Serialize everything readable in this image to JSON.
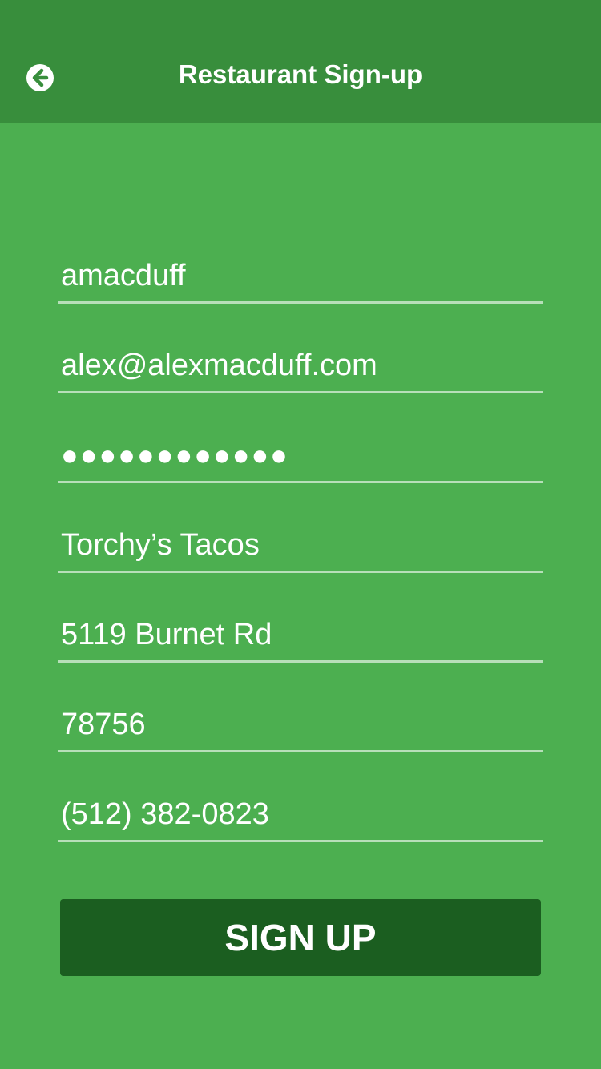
{
  "header": {
    "title": "Restaurant Sign-up",
    "back_icon": "arrow-left-circle-icon"
  },
  "form": {
    "username": "amacduff",
    "email": "alex@alexmacduff.com",
    "password_mask": "●●●●●●●●●●●●",
    "restaurant_name": "Torchy’s Tacos",
    "address": "5119 Burnet Rd",
    "zip": "78756",
    "phone": "(512) 382-0823"
  },
  "actions": {
    "signup_label": "SIGN UP"
  },
  "colors": {
    "background": "#4caf50",
    "header": "#388e3c",
    "button": "#1b5e20",
    "text": "#ffffff"
  }
}
